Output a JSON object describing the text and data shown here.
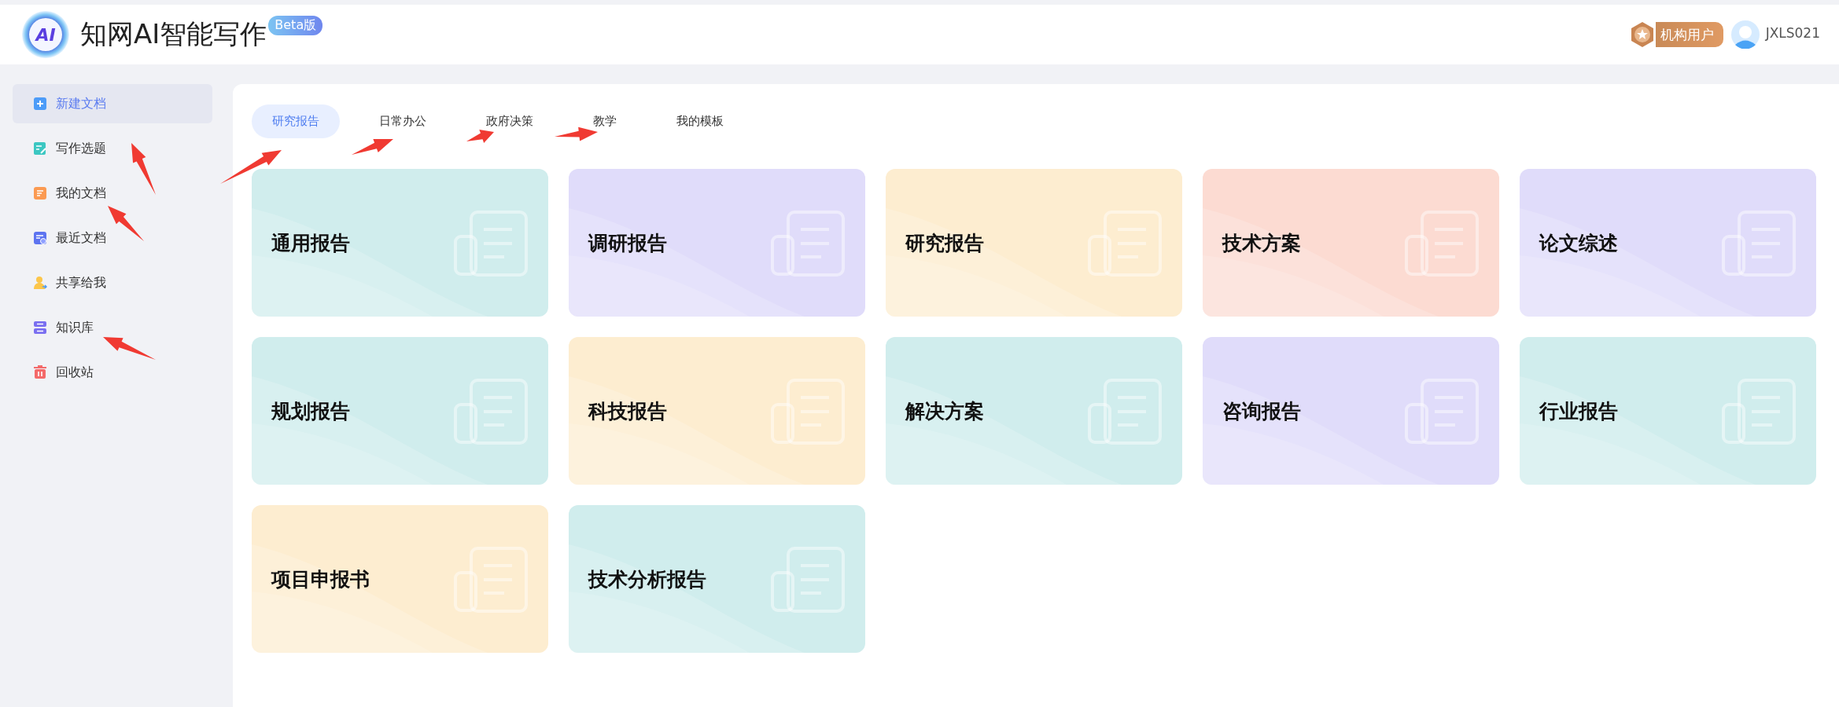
{
  "header": {
    "logo_text": "AI",
    "title": "知网AI智能写作",
    "badge": "Beta版",
    "user_type": "机构用户",
    "username": "JXLS021"
  },
  "sidebar": {
    "items": [
      {
        "label": "新建文档",
        "selected": true,
        "kind": "new"
      },
      {
        "label": "写作选题",
        "selected": false,
        "kind": "topic"
      },
      {
        "label": "我的文档",
        "selected": false,
        "kind": "docs"
      },
      {
        "label": "最近文档",
        "selected": false,
        "kind": "recent"
      },
      {
        "label": "共享给我",
        "selected": false,
        "kind": "shared"
      },
      {
        "label": "知识库",
        "selected": false,
        "kind": "library"
      },
      {
        "label": "回收站",
        "selected": false,
        "kind": "trash"
      }
    ]
  },
  "tabs": [
    {
      "label": "研究报告",
      "selected": true
    },
    {
      "label": "日常办公",
      "selected": false
    },
    {
      "label": "政府决策",
      "selected": false
    },
    {
      "label": "教学",
      "selected": false
    },
    {
      "label": "我的模板",
      "selected": false
    }
  ],
  "cards": [
    {
      "title": "通用报告",
      "color": "#d0eded"
    },
    {
      "title": "调研报告",
      "color": "#e0dcfa"
    },
    {
      "title": "研究报告",
      "color": "#fdedd0"
    },
    {
      "title": "技术方案",
      "color": "#fcdbd2"
    },
    {
      "title": "论文综述",
      "color": "#e0dcfa"
    },
    {
      "title": "规划报告",
      "color": "#d0eded"
    },
    {
      "title": "科技报告",
      "color": "#fdedd0"
    },
    {
      "title": "解决方案",
      "color": "#d0eded"
    },
    {
      "title": "咨询报告",
      "color": "#e0dcfa"
    },
    {
      "title": "行业报告",
      "color": "#d0eded"
    },
    {
      "title": "项目申报书",
      "color": "#fdedd0"
    },
    {
      "title": "技术分析报告",
      "color": "#d0eded"
    }
  ]
}
